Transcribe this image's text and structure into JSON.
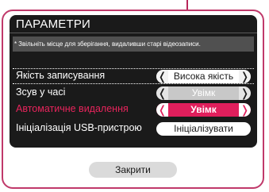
{
  "dialog": {
    "title": "ПАРАМЕТРИ",
    "notice_star": "*",
    "notice": "Звільніть місце для зберігання, видаливши старі відеозаписи."
  },
  "settings": [
    {
      "label": "Якість записування",
      "value": "Висока якість",
      "control": "spinner",
      "style": "white",
      "active": false
    },
    {
      "label": "Зсув у часі",
      "value": "Увімк",
      "control": "spinner",
      "style": "gray",
      "active": false
    },
    {
      "label": "Автоматичне видалення",
      "value": "Увімк",
      "control": "spinner",
      "style": "pink",
      "active": true
    },
    {
      "label": "Ініціалізація USB-пристрою",
      "value": "Ініціалізувати",
      "control": "button",
      "style": "white",
      "active": false
    }
  ],
  "arrows": {
    "left": "❬",
    "right": "❭"
  },
  "close_button": {
    "label": "Закрити"
  },
  "colors": {
    "accent": "#e01f5c",
    "frame": "#c0396a",
    "panel": "#1a1a1a"
  }
}
